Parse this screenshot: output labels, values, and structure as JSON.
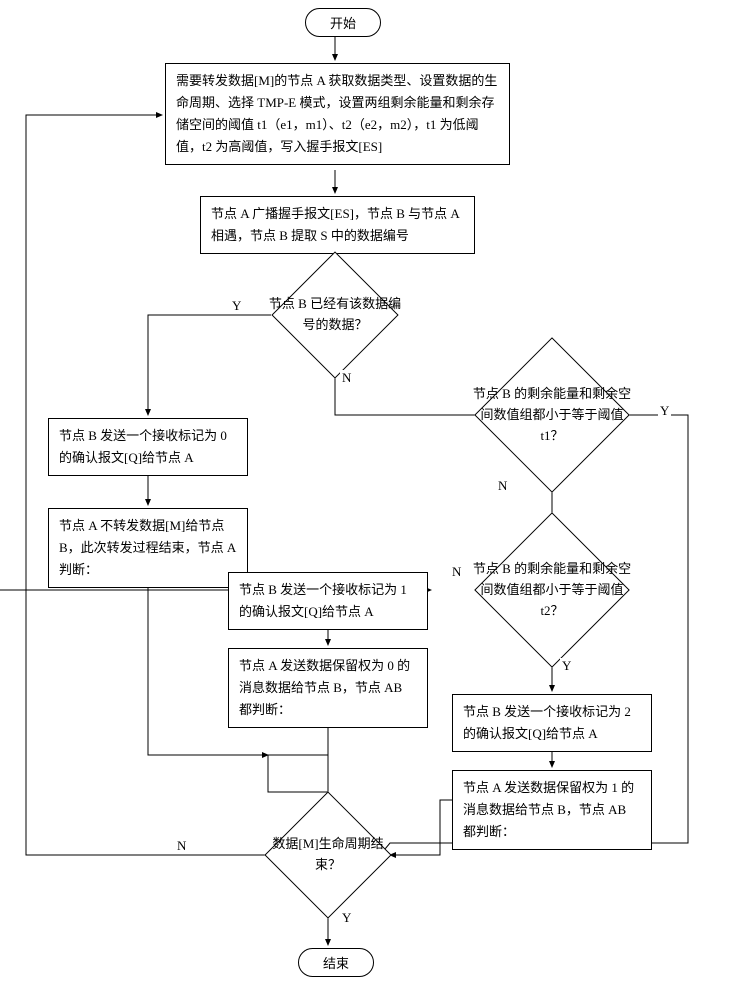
{
  "nodes": {
    "start": "开始",
    "end": "结束",
    "p1": "需要转发数据[M]的节点 A 获取数据类型、设置数据的生命周期、选择 TMP-E 模式，设置两组剩余能量和剩余存储空间的阈值 t1（e1，m1）、t2（e2，m2），t1 为低阈值，t2 为高阈值，写入握手报文[ES]",
    "p2": "节点 A 广播握手报文[ES]，节点 B 与节点 A 相遇，节点 B 提取 S 中的数据编号",
    "d1": "节点 B 已经有该数据编号的数据？",
    "d2": "节点 B 的剩余能量和剩余空间数值组都小于等于阈值 t1？",
    "d3": "节点 B 的剩余能量和剩余空间数值组都小于等于阈值 t2？",
    "p3": "节点 B 发送一个接收标记为 0 的确认报文[Q]给节点 A",
    "p4": "节点 A 不转发数据[M]给节点 B，此次转发过程结束，节点 A 判断：",
    "p5": "节点 B 发送一个接收标记为 1 的确认报文[Q]给节点 A",
    "p6": "节点 A 发送数据保留权为 0 的消息数据给节点 B，节点 AB 都判断：",
    "p7": "节点 B 发送一个接收标记为 2 的确认报文[Q]给节点 A",
    "p8": "节点 A 发送数据保留权为 1 的消息数据给节点 B，节点 AB 都判断：",
    "d4": "数据[M]生命周期结束？"
  },
  "labels": {
    "yes": "Y",
    "no": "N"
  }
}
